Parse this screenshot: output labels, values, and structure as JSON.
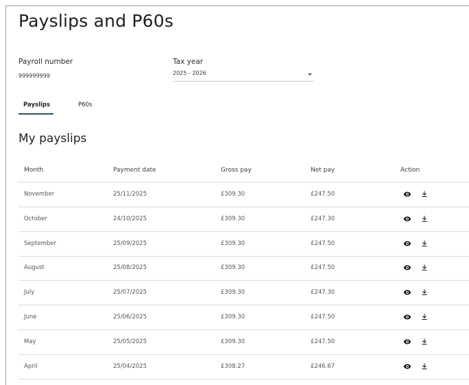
{
  "page_title": "Payslips and P60s",
  "payroll": {
    "label": "Payroll number",
    "value": "999999999"
  },
  "tax_year": {
    "label": "Tax year",
    "selected": "2025 - 2026"
  },
  "tabs": [
    {
      "label": "Payslips",
      "active": true
    },
    {
      "label": "P60s",
      "active": false
    }
  ],
  "section_title": "My payslips",
  "table": {
    "headers": [
      "Month",
      "Payment date",
      "Gross pay",
      "Net pay",
      "Action"
    ],
    "rows": [
      {
        "month": "November",
        "payment_date": "25/11/2025",
        "gross_pay": "£309.30",
        "net_pay": "£247.50"
      },
      {
        "month": "October",
        "payment_date": "24/10/2025",
        "gross_pay": "£309.30",
        "net_pay": "£247.30"
      },
      {
        "month": "September",
        "payment_date": "25/09/2025",
        "gross_pay": "£309.30",
        "net_pay": "£247.50"
      },
      {
        "month": "August",
        "payment_date": "25/08/2025",
        "gross_pay": "£309.30",
        "net_pay": "£247.50"
      },
      {
        "month": "July",
        "payment_date": "25/07/2025",
        "gross_pay": "£309.30",
        "net_pay": "£247.30"
      },
      {
        "month": "June",
        "payment_date": "25/06/2025",
        "gross_pay": "£309.30",
        "net_pay": "£247.50"
      },
      {
        "month": "May",
        "payment_date": "25/05/2025",
        "gross_pay": "£309.30",
        "net_pay": "£247.50"
      },
      {
        "month": "April",
        "payment_date": "25/04/2025",
        "gross_pay": "£308.27",
        "net_pay": "£246.67"
      }
    ],
    "action_icons": [
      "eye-icon",
      "download-icon"
    ]
  },
  "colors": {
    "tab_underline": "#2d4f63",
    "divider": "#dcdcdc"
  }
}
